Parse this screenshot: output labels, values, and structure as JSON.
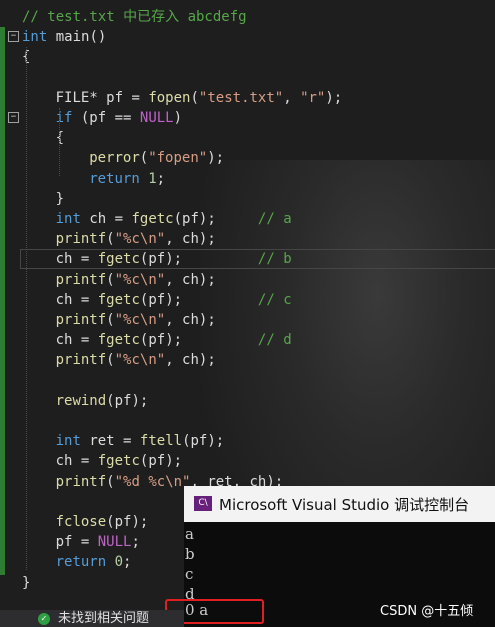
{
  "editor": {
    "lines": [
      {
        "indent": 0,
        "tokens": [
          {
            "t": "// test.txt 中已存入 abcdefg",
            "c": "cm"
          }
        ]
      },
      {
        "indent": 0,
        "fold": "−",
        "tokens": [
          {
            "t": "int",
            "c": "kw"
          },
          {
            "t": " main()",
            "c": "tx"
          }
        ]
      },
      {
        "indent": 0,
        "tokens": [
          {
            "t": "{",
            "c": "tx"
          }
        ]
      },
      {
        "indent": 0,
        "tokens": []
      },
      {
        "indent": 1,
        "tokens": [
          {
            "t": "FILE",
            "c": "tx"
          },
          {
            "t": "* pf = ",
            "c": "tx"
          },
          {
            "t": "fopen",
            "c": "fn"
          },
          {
            "t": "(",
            "c": "tx"
          },
          {
            "t": "\"test.txt\"",
            "c": "st"
          },
          {
            "t": ", ",
            "c": "tx"
          },
          {
            "t": "\"r\"",
            "c": "st"
          },
          {
            "t": ");",
            "c": "tx"
          }
        ]
      },
      {
        "indent": 1,
        "fold": "−",
        "tokens": [
          {
            "t": "if",
            "c": "kw"
          },
          {
            "t": " (pf == ",
            "c": "tx"
          },
          {
            "t": "NULL",
            "c": "mc"
          },
          {
            "t": ")",
            "c": "tx"
          }
        ]
      },
      {
        "indent": 1,
        "tokens": [
          {
            "t": "{",
            "c": "tx"
          }
        ]
      },
      {
        "indent": 2,
        "tokens": [
          {
            "t": "perror",
            "c": "fn"
          },
          {
            "t": "(",
            "c": "tx"
          },
          {
            "t": "\"fopen\"",
            "c": "st"
          },
          {
            "t": ");",
            "c": "tx"
          }
        ]
      },
      {
        "indent": 2,
        "tokens": [
          {
            "t": "return",
            "c": "kw"
          },
          {
            "t": " ",
            "c": "tx"
          },
          {
            "t": "1",
            "c": "nm"
          },
          {
            "t": ";",
            "c": "tx"
          }
        ]
      },
      {
        "indent": 1,
        "tokens": [
          {
            "t": "}",
            "c": "tx"
          }
        ]
      },
      {
        "indent": 1,
        "tokens": [
          {
            "t": "int",
            "c": "kw"
          },
          {
            "t": " ch = ",
            "c": "tx"
          },
          {
            "t": "fgetc",
            "c": "fn"
          },
          {
            "t": "(pf);     ",
            "c": "tx"
          },
          {
            "t": "// a",
            "c": "cm"
          }
        ]
      },
      {
        "indent": 1,
        "tokens": [
          {
            "t": "printf",
            "c": "fn"
          },
          {
            "t": "(",
            "c": "tx"
          },
          {
            "t": "\"%c\\n\"",
            "c": "st"
          },
          {
            "t": ", ch);",
            "c": "tx"
          }
        ]
      },
      {
        "indent": 1,
        "tokens": [
          {
            "t": "ch = ",
            "c": "tx"
          },
          {
            "t": "fgetc",
            "c": "fn"
          },
          {
            "t": "(pf);         ",
            "c": "tx"
          },
          {
            "t": "// b",
            "c": "cm"
          }
        ]
      },
      {
        "indent": 1,
        "tokens": [
          {
            "t": "printf",
            "c": "fn"
          },
          {
            "t": "(",
            "c": "tx"
          },
          {
            "t": "\"%c\\n\"",
            "c": "st"
          },
          {
            "t": ", ch);",
            "c": "tx"
          }
        ]
      },
      {
        "indent": 1,
        "tokens": [
          {
            "t": "ch = ",
            "c": "tx"
          },
          {
            "t": "fgetc",
            "c": "fn"
          },
          {
            "t": "(pf);         ",
            "c": "tx"
          },
          {
            "t": "// c",
            "c": "cm"
          }
        ]
      },
      {
        "indent": 1,
        "tokens": [
          {
            "t": "printf",
            "c": "fn"
          },
          {
            "t": "(",
            "c": "tx"
          },
          {
            "t": "\"%c\\n\"",
            "c": "st"
          },
          {
            "t": ", ch);",
            "c": "tx"
          }
        ]
      },
      {
        "indent": 1,
        "tokens": [
          {
            "t": "ch = ",
            "c": "tx"
          },
          {
            "t": "fgetc",
            "c": "fn"
          },
          {
            "t": "(pf);         ",
            "c": "tx"
          },
          {
            "t": "// d",
            "c": "cm"
          }
        ]
      },
      {
        "indent": 1,
        "tokens": [
          {
            "t": "printf",
            "c": "fn"
          },
          {
            "t": "(",
            "c": "tx"
          },
          {
            "t": "\"%c\\n\"",
            "c": "st"
          },
          {
            "t": ", ch);",
            "c": "tx"
          }
        ]
      },
      {
        "indent": 1,
        "tokens": []
      },
      {
        "indent": 1,
        "tokens": [
          {
            "t": "rewind",
            "c": "fn"
          },
          {
            "t": "(pf);",
            "c": "tx"
          }
        ]
      },
      {
        "indent": 1,
        "tokens": []
      },
      {
        "indent": 1,
        "tokens": [
          {
            "t": "int",
            "c": "kw"
          },
          {
            "t": " ret = ",
            "c": "tx"
          },
          {
            "t": "ftell",
            "c": "fn"
          },
          {
            "t": "(pf);",
            "c": "tx"
          }
        ]
      },
      {
        "indent": 1,
        "tokens": [
          {
            "t": "ch = ",
            "c": "tx"
          },
          {
            "t": "fgetc",
            "c": "fn"
          },
          {
            "t": "(pf);",
            "c": "tx"
          }
        ]
      },
      {
        "indent": 1,
        "tokens": [
          {
            "t": "printf",
            "c": "fn"
          },
          {
            "t": "(",
            "c": "tx"
          },
          {
            "t": "\"%d %c\\n\"",
            "c": "st"
          },
          {
            "t": ", ret, ch);",
            "c": "tx"
          }
        ]
      },
      {
        "indent": 1,
        "tokens": []
      },
      {
        "indent": 1,
        "tokens": [
          {
            "t": "fclose",
            "c": "fn"
          },
          {
            "t": "(pf);",
            "c": "tx"
          }
        ]
      },
      {
        "indent": 1,
        "tokens": [
          {
            "t": "pf = ",
            "c": "tx"
          },
          {
            "t": "NULL",
            "c": "mc"
          },
          {
            "t": ";",
            "c": "tx"
          }
        ]
      },
      {
        "indent": 1,
        "tokens": [
          {
            "t": "return",
            "c": "kw"
          },
          {
            "t": " ",
            "c": "tx"
          },
          {
            "t": "0",
            "c": "nm"
          },
          {
            "t": ";",
            "c": "tx"
          }
        ]
      },
      {
        "indent": 0,
        "tokens": [
          {
            "t": "}",
            "c": "tx"
          }
        ]
      }
    ]
  },
  "console": {
    "title": "Microsoft Visual Studio 调试控制台",
    "icon_label": "C\\",
    "output_lines": [
      "a",
      "b",
      "c",
      "d",
      "0 a"
    ]
  },
  "status": {
    "text": "未找到相关问题"
  },
  "watermark": "CSDN @十五倾",
  "colors": {
    "comment": "#57a64a",
    "keyword": "#569cd6",
    "string": "#d69d85",
    "function": "#dcdcaa",
    "highlight_box": "#e02020",
    "change_bar": "#2e7d32"
  }
}
